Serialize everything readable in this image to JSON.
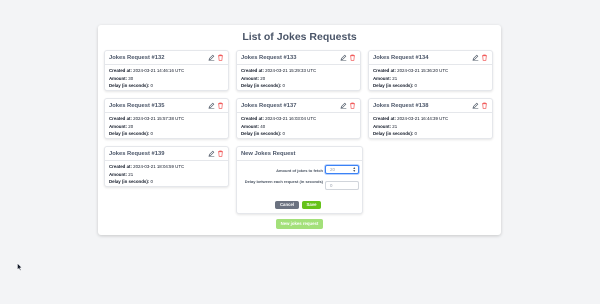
{
  "page": {
    "title": "List of Jokes Requests"
  },
  "labels": {
    "created_at": "Created at:",
    "amount": "Amount:",
    "delay": "Delay (in seconds):"
  },
  "cards": [
    {
      "title": "Jokes Request #132",
      "created_at": "2024-03-21 14:46:16 UTC",
      "amount": "30",
      "delay": "0"
    },
    {
      "title": "Jokes Request #133",
      "created_at": "2024-03-21 15:29:33 UTC",
      "amount": "20",
      "delay": "0"
    },
    {
      "title": "Jokes Request #134",
      "created_at": "2024-03-21 15:36:20 UTC",
      "amount": "21",
      "delay": "0"
    },
    {
      "title": "Jokes Request #135",
      "created_at": "2024-03-21 15:57:38 UTC",
      "amount": "20",
      "delay": "0"
    },
    {
      "title": "Jokes Request #137",
      "created_at": "2024-03-21 16:03:04 UTC",
      "amount": "40",
      "delay": "0"
    },
    {
      "title": "Jokes Request #138",
      "created_at": "2024-03-21 16:44:39 UTC",
      "amount": "21",
      "delay": "0"
    },
    {
      "title": "Jokes Request #139",
      "created_at": "2024-03-21 18:04:59 UTC",
      "amount": "21",
      "delay": "0"
    }
  ],
  "icons": {
    "edit": "edit-icon",
    "delete": "trash-icon",
    "edit_color": "#4b5563",
    "delete_color": "#ef4444"
  },
  "form": {
    "title": "New Jokes Request",
    "amount_label": "Amount of jokes to fetch",
    "amount_value": "20",
    "delay_label": "Delay between each request (in seconds)",
    "delay_value": "0",
    "cancel_label": "Cancel",
    "save_label": "Save"
  },
  "new_request_button": "New jokes request",
  "colors": {
    "save": "#65c21a",
    "cancel": "#6b7280",
    "new_request": "#a3e07a"
  }
}
